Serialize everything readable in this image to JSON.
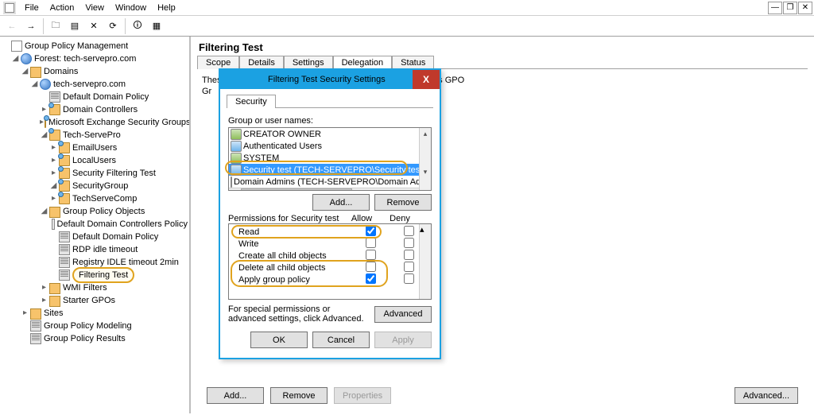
{
  "menu": {
    "items": [
      "File",
      "Action",
      "View",
      "Window",
      "Help"
    ]
  },
  "toolbar": {
    "back": "←",
    "fwd": "→",
    "up": "↑",
    "props": "▦",
    "refresh": "⟳",
    "help": "?",
    "run": "▣",
    "list": "≣"
  },
  "tree": {
    "root": "Group Policy Management",
    "forest": "Forest: tech-servepro.com",
    "domains": "Domains",
    "domain": "tech-servepro.com",
    "items_ou": [
      "Default Domain Policy",
      "Domain Controllers",
      "Microsoft Exchange Security Groups"
    ],
    "techservepro": "Tech-ServePro",
    "tsp_children": [
      "EmailUsers",
      "LocalUsers",
      "Security Filtering Test",
      "SecurityGroup",
      "TechServeComp"
    ],
    "gpo": "Group Policy Objects",
    "gpo_children": [
      "Default Domain Controllers Policy",
      "Default Domain Policy",
      "RDP idle timeout",
      "Registry IDLE timeout 2min",
      "Filtering Test"
    ],
    "wmi": "WMI Filters",
    "starter": "Starter GPOs",
    "sites": "Sites",
    "modeling": "Group Policy Modeling",
    "results": "Group Policy Results"
  },
  "gpo_header": "Filtering Test",
  "tabs": [
    "Scope",
    "Details",
    "Settings",
    "Delegation",
    "Status"
  ],
  "active_tab": "Delegation",
  "delegation_text": "These groups and users have the specified permission for this GPO",
  "delegation_grid_prefix": "Gr",
  "btns": {
    "add": "Add...",
    "remove": "Remove",
    "properties": "Properties",
    "advanced": "Advanced..."
  },
  "dialog": {
    "title": "Filtering Test Security Settings",
    "security_tab": "Security",
    "group_label": "Group or user names:",
    "groups": [
      "CREATOR OWNER",
      "Authenticated Users",
      "SYSTEM",
      "Security test (TECH-SERVEPRO\\Security test)",
      "Domain Admins (TECH-SERVEPRO\\Domain Admins)"
    ],
    "selected_group_index": 3,
    "add": "Add...",
    "remove": "Remove",
    "perm_header": "Permissions for Security test",
    "allow": "Allow",
    "deny": "Deny",
    "perms": [
      {
        "label": "Read",
        "allow": true,
        "deny": false,
        "hl": true
      },
      {
        "label": "Write",
        "allow": false,
        "deny": false,
        "hl": false
      },
      {
        "label": "Create all child objects",
        "allow": false,
        "deny": false,
        "hl": false
      },
      {
        "label": "Delete all child objects",
        "allow": false,
        "deny": false,
        "hl": "grp"
      },
      {
        "label": "Apply group policy",
        "allow": true,
        "deny": false,
        "hl": "grp"
      }
    ],
    "adv_text": "For special permissions or advanced settings, click Advanced.",
    "adv_btn": "Advanced",
    "ok": "OK",
    "cancel": "Cancel",
    "apply": "Apply"
  }
}
